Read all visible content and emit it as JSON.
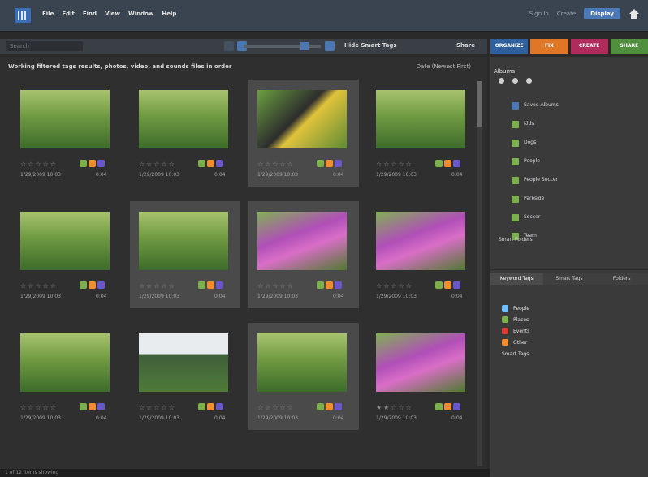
{
  "menubar": {
    "items": [
      "File",
      "Edit",
      "Find",
      "View",
      "Window",
      "Help"
    ],
    "right": [
      "Sign In",
      "Create",
      "Display"
    ]
  },
  "toolbar": {
    "search_placeholder": "Search",
    "thumb_label": "Hide Smart Tags",
    "share_label": "Share"
  },
  "modes": [
    {
      "label": "ORGANIZE",
      "color": "#2f5f9c"
    },
    {
      "label": "FIX",
      "color": "#e07726"
    },
    {
      "label": "CREATE",
      "color": "#b02a5c"
    },
    {
      "label": "SHARE",
      "color": "#4f8f3e"
    }
  ],
  "content": {
    "header": "Working filtered tags results, photos, video, and sounds files in order",
    "sort": "Date (Newest First)"
  },
  "photos": [
    {
      "date": "1/29/2009 10:03",
      "size": "0:04",
      "rating": 0,
      "scene": "green",
      "selected": false
    },
    {
      "date": "1/29/2009 10:03",
      "size": "0:04",
      "rating": 0,
      "scene": "green",
      "selected": false
    },
    {
      "date": "1/29/2009 10:03",
      "size": "0:04",
      "rating": 0,
      "scene": "yellow",
      "selected": true
    },
    {
      "date": "1/29/2009 10:03",
      "size": "0:04",
      "rating": 0,
      "scene": "green",
      "selected": false
    },
    {
      "date": "1/29/2009 10:03",
      "size": "0:04",
      "rating": 0,
      "scene": "green",
      "selected": false
    },
    {
      "date": "1/29/2009 10:03",
      "size": "0:04",
      "rating": 0,
      "scene": "green",
      "selected": true
    },
    {
      "date": "1/29/2009 10:03",
      "size": "0:04",
      "rating": 0,
      "scene": "purple",
      "selected": true
    },
    {
      "date": "1/29/2009 10:03",
      "size": "0:04",
      "rating": 0,
      "scene": "purple",
      "selected": false
    },
    {
      "date": "1/29/2009 10:03",
      "size": "0:04",
      "rating": 0,
      "scene": "green",
      "selected": false
    },
    {
      "date": "1/29/2009 10:03",
      "size": "0:04",
      "rating": 0,
      "scene": "trees",
      "selected": false
    },
    {
      "date": "1/29/2009 10:03",
      "size": "0:04",
      "rating": 0,
      "scene": "green",
      "selected": true
    },
    {
      "date": "1/29/2009 10:03",
      "size": "0:04",
      "rating": 2,
      "scene": "purple",
      "selected": false
    }
  ],
  "status": "1 of 12 items showing",
  "albums": {
    "title": "Albums",
    "items": [
      "Saved Albums",
      "Kids",
      "Dogs",
      "People",
      "People Soccer",
      "Parkside",
      "Soccer",
      "Team"
    ],
    "subheading": "Smart Folders"
  },
  "tags": {
    "tabs": [
      "Keyword Tags",
      "Smart Tags",
      "Folders"
    ],
    "items": [
      {
        "label": "People",
        "color": "#6ec0ff"
      },
      {
        "label": "Places",
        "color": "#7bb04d"
      },
      {
        "label": "Events",
        "color": "#e03c3c"
      },
      {
        "label": "Other",
        "color": "#f08d30"
      }
    ],
    "subheading": "Smart Tags"
  }
}
